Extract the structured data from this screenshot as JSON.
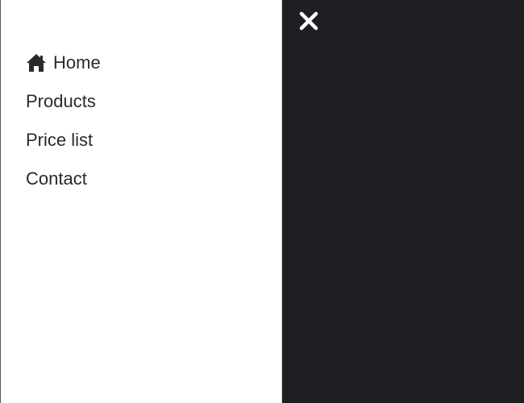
{
  "nav": {
    "items": [
      {
        "label": "Home",
        "icon": "home-icon"
      },
      {
        "label": "Products"
      },
      {
        "label": "Price list"
      },
      {
        "label": "Contact"
      }
    ]
  },
  "overlay": {
    "close_icon": "close-icon"
  },
  "colors": {
    "drawer_bg": "#ffffff",
    "overlay_bg": "#1f1e23",
    "text": "#2a2a2a",
    "close": "#ffffff"
  }
}
